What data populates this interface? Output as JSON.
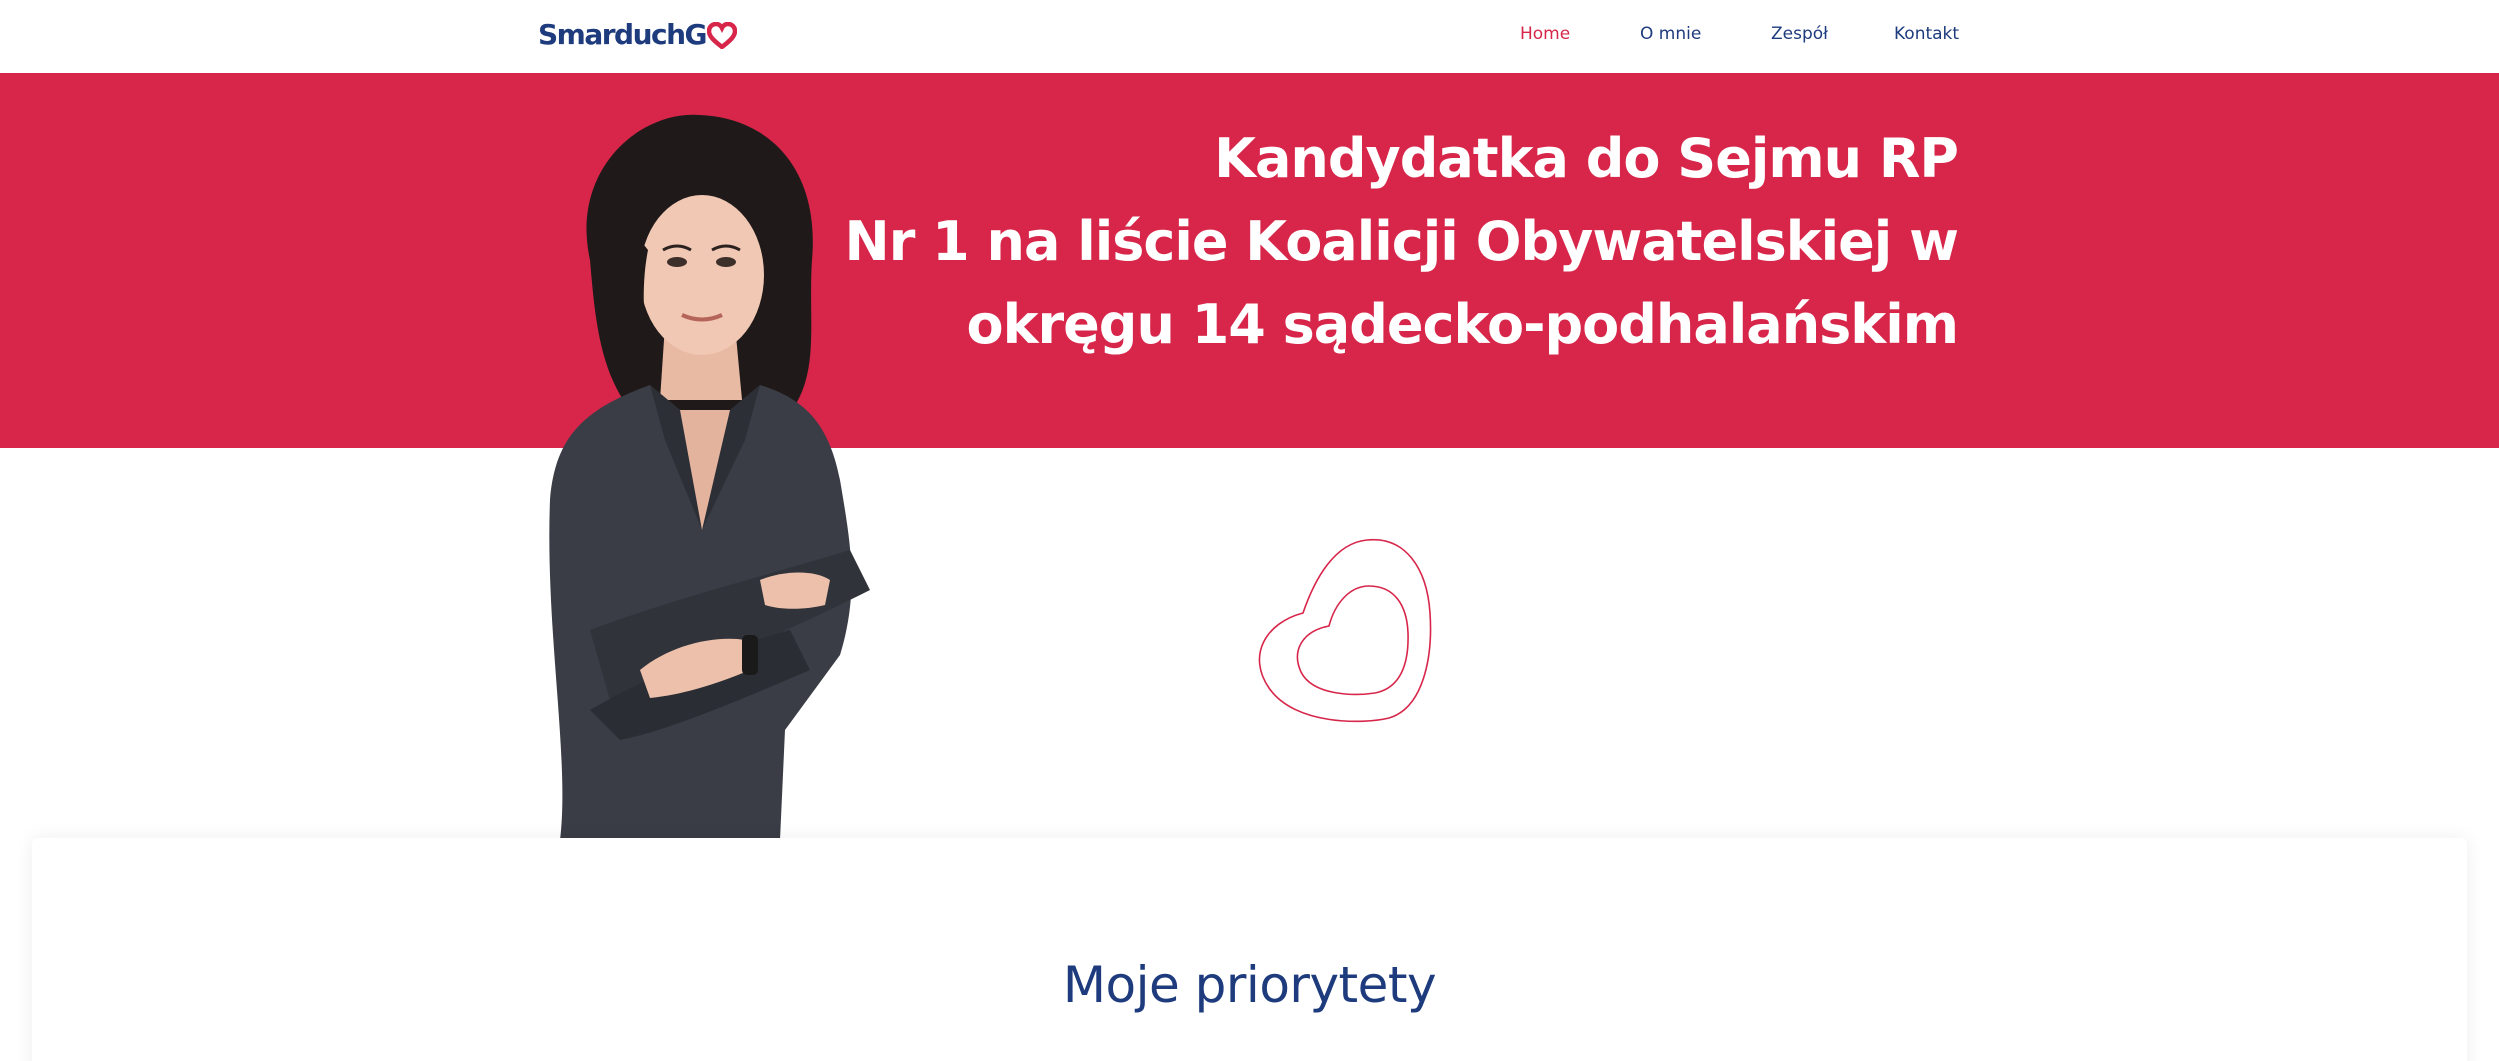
{
  "brand": {
    "logo_text": "SmarduchG",
    "logo_icon": "heart-logo-icon",
    "colors": {
      "navy": "#1d3b7d",
      "red": "#d7264a",
      "white": "#ffffff"
    }
  },
  "nav": {
    "items": [
      {
        "label": "Home",
        "active": true
      },
      {
        "label": "O mnie",
        "active": false
      },
      {
        "label": "Zespół",
        "active": false
      },
      {
        "label": "Kontakt",
        "active": false
      }
    ]
  },
  "hero": {
    "lines": [
      "Kandydatka do Sejmu RP",
      "Nr 1 na liście Koalicji Obywatelskiej w",
      "okręgu 14 sądecko-podhalańskim"
    ]
  },
  "priorities": {
    "title": "Moje priorytety"
  }
}
